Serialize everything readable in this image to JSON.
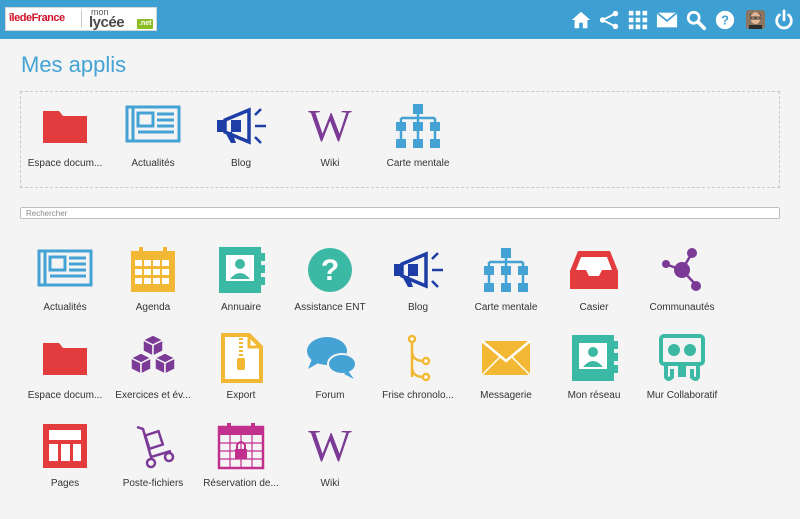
{
  "header": {
    "logo_region": "îledeFrance",
    "logo_mon": "mon",
    "logo_lycee": "lycée",
    "logo_net": ".net",
    "icons": [
      "home-icon",
      "share-icon",
      "apps-grid-icon",
      "mail-icon",
      "search-icon",
      "help-icon",
      "user-avatar",
      "power-icon"
    ]
  },
  "page": {
    "title": "Mes applis"
  },
  "favorites": [
    {
      "label": "Espace docum...",
      "icon": "folder-icon"
    },
    {
      "label": "Actualités",
      "icon": "newspaper-icon"
    },
    {
      "label": "Blog",
      "icon": "megaphone-icon"
    },
    {
      "label": "Wiki",
      "icon": "wiki-icon"
    },
    {
      "label": "Carte mentale",
      "icon": "hierarchy-icon"
    }
  ],
  "search": {
    "placeholder": "Rechercher"
  },
  "apps": [
    {
      "label": "Actualités",
      "icon": "newspaper-icon"
    },
    {
      "label": "Agenda",
      "icon": "calendar-icon"
    },
    {
      "label": "Annuaire",
      "icon": "contact-book-icon"
    },
    {
      "label": "Assistance ENT",
      "icon": "question-icon"
    },
    {
      "label": "Blog",
      "icon": "megaphone-icon"
    },
    {
      "label": "Carte mentale",
      "icon": "hierarchy-icon"
    },
    {
      "label": "Casier",
      "icon": "inbox-tray-icon"
    },
    {
      "label": "Communautés",
      "icon": "share-nodes-icon"
    },
    {
      "label": "Espace docum...",
      "icon": "folder-icon"
    },
    {
      "label": "Exercices et év...",
      "icon": "cubes-icon"
    },
    {
      "label": "Export",
      "icon": "zip-file-icon"
    },
    {
      "label": "Forum",
      "icon": "chat-bubbles-icon"
    },
    {
      "label": "Frise chronolo...",
      "icon": "timeline-icon"
    },
    {
      "label": "Messagerie",
      "icon": "envelope-icon"
    },
    {
      "label": "Mon réseau",
      "icon": "contact-book-icon"
    },
    {
      "label": "Mur Collaboratif",
      "icon": "collab-board-icon"
    },
    {
      "label": "Pages",
      "icon": "pages-layout-icon"
    },
    {
      "label": "Poste-fichiers",
      "icon": "hand-truck-icon"
    },
    {
      "label": "Réservation de...",
      "icon": "calendar-lock-icon"
    },
    {
      "label": "Wiki",
      "icon": "wiki-icon"
    }
  ],
  "colors": {
    "topbar": "#3d9fd2",
    "title": "#43a3d4",
    "red": "#e33c3f",
    "blue": "#45a2d4",
    "navy": "#1d3ea6",
    "purple": "#7b3a96",
    "yellow": "#f2b833",
    "teal": "#3cb9a5",
    "pink": "#c2308e"
  }
}
